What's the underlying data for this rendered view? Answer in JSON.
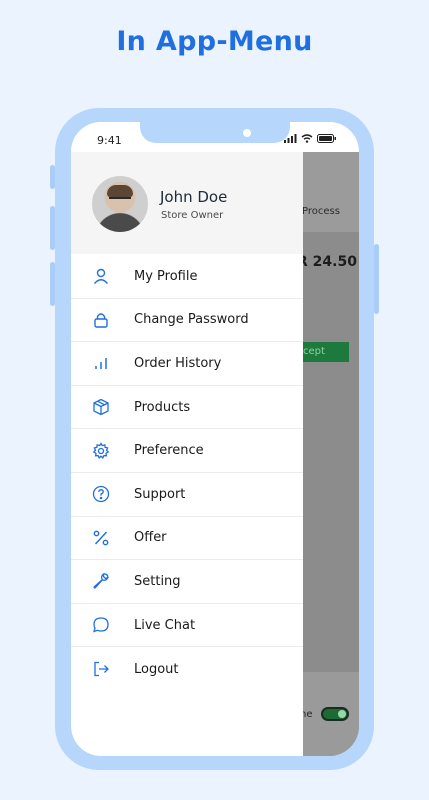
{
  "headline": "In App-Menu",
  "status_bar": {
    "time": "9:41"
  },
  "profile": {
    "name": "John Doe",
    "role": "Store Owner"
  },
  "menu": [
    {
      "label": "My Profile",
      "icon": "user-icon"
    },
    {
      "label": "Change Password",
      "icon": "lock-icon"
    },
    {
      "label": "Order History",
      "icon": "bar-chart-icon"
    },
    {
      "label": "Products",
      "icon": "box-icon"
    },
    {
      "label": "Preference",
      "icon": "gear-icon"
    },
    {
      "label": "Support",
      "icon": "help-circle-icon"
    },
    {
      "label": "Offer",
      "icon": "percent-icon"
    },
    {
      "label": "Setting",
      "icon": "wrench-icon"
    },
    {
      "label": "Live Chat",
      "icon": "chat-bubble-icon"
    },
    {
      "label": "Logout",
      "icon": "logout-icon"
    }
  ],
  "background_app": {
    "process_text": "Process",
    "price_text": "R 24.50",
    "accept_text": "cept",
    "toggle_label": "ne"
  },
  "colors": {
    "accent": "#1f6fe0",
    "frame": "#b6d6fb",
    "background": "#eaf3fe",
    "icon": "#1f6fe0"
  }
}
